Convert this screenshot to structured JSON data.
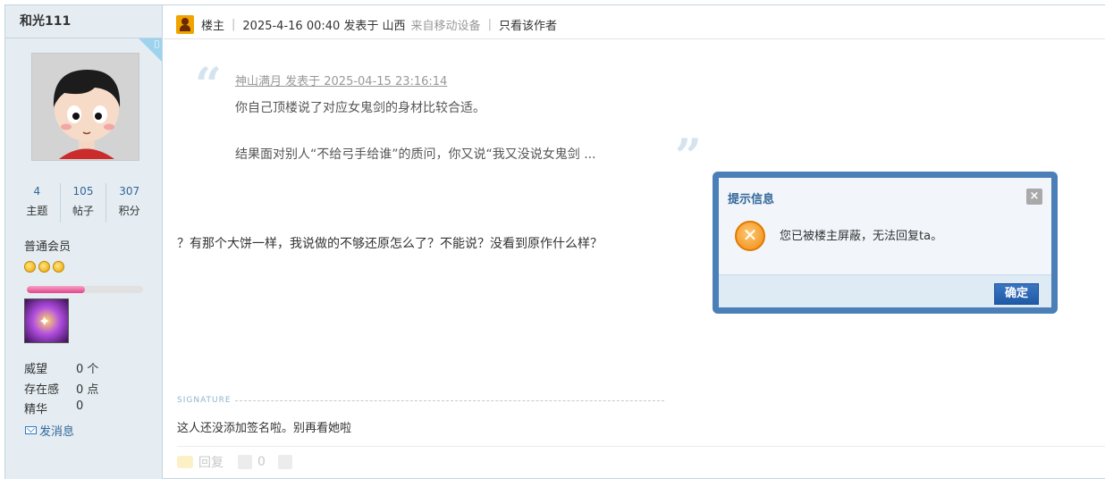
{
  "sidebar": {
    "username": "和光111",
    "stats": [
      {
        "value": "4",
        "label": "主题"
      },
      {
        "value": "105",
        "label": "帖子"
      },
      {
        "value": "307",
        "label": "积分"
      }
    ],
    "group": "普通会员",
    "star_count": 3,
    "progress_fraction": 0.5,
    "credits": [
      {
        "key": "威望",
        "value": "0 个"
      },
      {
        "key": "存在感",
        "value": "0 点"
      },
      {
        "key": "精华",
        "value": "0"
      }
    ],
    "send_message_label": "发消息"
  },
  "post": {
    "role": "楼主",
    "posted": "2025-4-16 00:40 发表于 山西",
    "device": "来自移动设备",
    "author_only": "只看该作者",
    "quote": {
      "header": "神山满月 发表于 2025-04-15 23:16:14",
      "line1": "你自己顶楼说了对应女鬼剑的身材比较合适。",
      "line2": "结果面对别人“不给弓手给谁”的质问，你又说“我又没说女鬼剑 ..."
    },
    "body": "？有那个大饼一样，我说做的不够还原怎么了？不能说？没看到原作什么样？",
    "signature_label": "SIGNATURE",
    "signature": "这人还没添加签名啦。别再看她啦",
    "reply_label": "回复",
    "like_count": "0"
  },
  "dialog": {
    "title": "提示信息",
    "message": "您已被楼主屏蔽，无法回复ta。",
    "ok_label": "确定",
    "close_symbol": "×",
    "icon": "warning-x-icon"
  }
}
